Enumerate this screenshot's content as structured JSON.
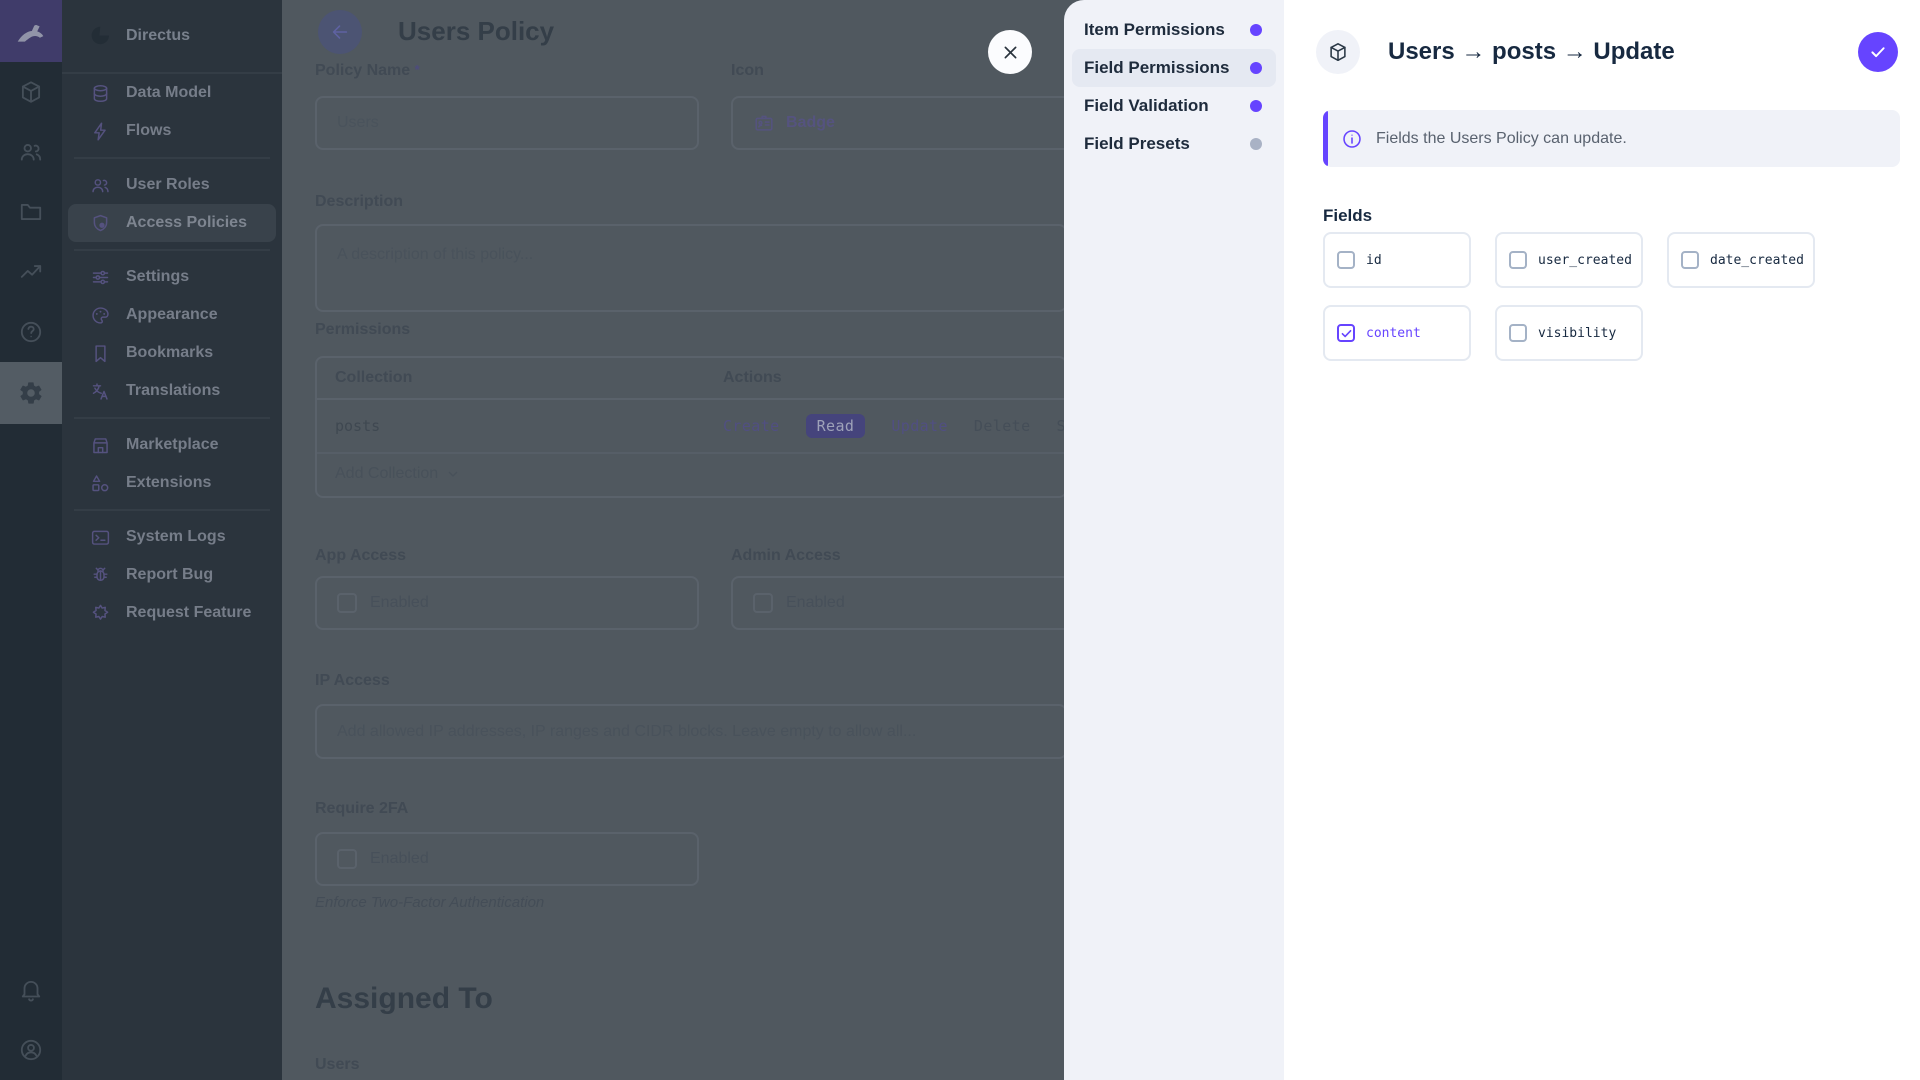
{
  "accent_color": "#6644FF",
  "dot_colors": {
    "purple": "#6644FF",
    "gray": "#A9B2C5"
  },
  "module_bar": {
    "logo_icon": "rabbit-logo",
    "modules": [
      {
        "icon": "box",
        "active": false
      },
      {
        "icon": "people",
        "active": false
      },
      {
        "icon": "folder",
        "active": false
      },
      {
        "icon": "chart",
        "active": false
      },
      {
        "icon": "help",
        "active": false
      },
      {
        "icon": "gear",
        "active": true
      }
    ],
    "bottom": [
      {
        "icon": "bell"
      },
      {
        "icon": "avatar"
      }
    ]
  },
  "sidebar": {
    "project_name": "Directus",
    "project_icon": "fan-logo",
    "sections": [
      {
        "items": [
          {
            "icon": "database",
            "label": "Data Model",
            "active": false
          },
          {
            "icon": "bolt",
            "label": "Flows",
            "active": false
          }
        ]
      },
      {
        "items": [
          {
            "icon": "people",
            "label": "User Roles",
            "active": false
          },
          {
            "icon": "shield",
            "label": "Access Policies",
            "active": true
          }
        ]
      },
      {
        "items": [
          {
            "icon": "tune",
            "label": "Settings",
            "active": false
          },
          {
            "icon": "palette",
            "label": "Appearance",
            "active": false
          },
          {
            "icon": "bookmark",
            "label": "Bookmarks",
            "active": false
          },
          {
            "icon": "translate",
            "label": "Translations",
            "active": false
          }
        ]
      },
      {
        "items": [
          {
            "icon": "store",
            "label": "Marketplace",
            "active": false
          },
          {
            "icon": "shapes",
            "label": "Extensions",
            "active": false
          }
        ]
      },
      {
        "items": [
          {
            "icon": "terminal",
            "label": "System Logs",
            "active": false
          },
          {
            "icon": "bug",
            "label": "Report Bug",
            "active": false
          },
          {
            "icon": "star",
            "label": "Request Feature",
            "active": false
          }
        ]
      }
    ]
  },
  "main": {
    "title": "Users Policy",
    "policy_name": {
      "label": "Policy Name",
      "required": "*",
      "value": "Users"
    },
    "icon_field": {
      "label": "Icon",
      "value": "Badge",
      "icon": "badge"
    },
    "description": {
      "label": "Description",
      "placeholder": "A description of this policy..."
    },
    "permissions": {
      "label": "Permissions",
      "columns": [
        "Collection",
        "Actions"
      ],
      "rows": [
        {
          "collection": "posts",
          "actions": [
            {
              "label": "Create",
              "state": "on"
            },
            {
              "label": "Read",
              "state": "selected"
            },
            {
              "label": "Update",
              "state": "on"
            },
            {
              "label": "Delete",
              "state": "off"
            },
            {
              "label": "Share",
              "state": "off"
            }
          ]
        }
      ],
      "footer": "Add Collection"
    },
    "app_access": {
      "label": "App Access",
      "checkbox": "Enabled",
      "checked": false
    },
    "admin_access": {
      "label": "Admin Access",
      "checkbox": "Enabled",
      "checked": false
    },
    "ip_access": {
      "label": "IP Access",
      "placeholder": "Add allowed IP addresses, IP ranges and CIDR blocks. Leave empty to allow all..."
    },
    "require_2fa": {
      "label": "Require 2FA",
      "checkbox": "Enabled",
      "checked": false,
      "note": "Enforce Two-Factor Authentication"
    },
    "assigned_to": {
      "heading": "Assigned To",
      "users_label": "Users"
    }
  },
  "drawer": {
    "nav": [
      {
        "label": "Item Permissions",
        "dot": "purple",
        "active": false
      },
      {
        "label": "Field Permissions",
        "dot": "purple",
        "active": true
      },
      {
        "label": "Field Validation",
        "dot": "purple",
        "active": false
      },
      {
        "label": "Field Presets",
        "dot": "gray",
        "active": false
      }
    ],
    "header": {
      "icon": "box",
      "title": "Users → posts → Update"
    },
    "banner": {
      "icon": "info",
      "text": "Fields the Users Policy can update."
    },
    "fields_label": "Fields",
    "fields": [
      {
        "name": "id",
        "checked": false
      },
      {
        "name": "user_created",
        "checked": false
      },
      {
        "name": "date_created",
        "checked": false
      },
      {
        "name": "content",
        "checked": true
      },
      {
        "name": "visibility",
        "checked": false
      }
    ]
  }
}
